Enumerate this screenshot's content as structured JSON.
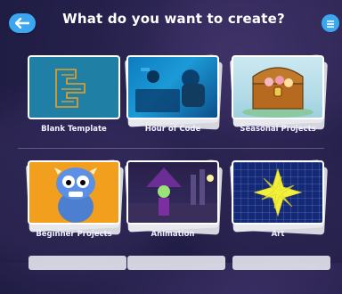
{
  "header": {
    "title": "What do you want to create?",
    "back_icon": "back-arrow-icon",
    "menu_icon": "menu-icon"
  },
  "projects": [
    {
      "label": "Blank Template"
    },
    {
      "label": "Hour of Code"
    },
    {
      "label": "Seasonal Projects"
    },
    {
      "label": "Beginner Projects"
    },
    {
      "label": "Animation"
    },
    {
      "label": "Art"
    }
  ],
  "colors": {
    "accent": "#3aa7f0",
    "background": "#24204a"
  }
}
